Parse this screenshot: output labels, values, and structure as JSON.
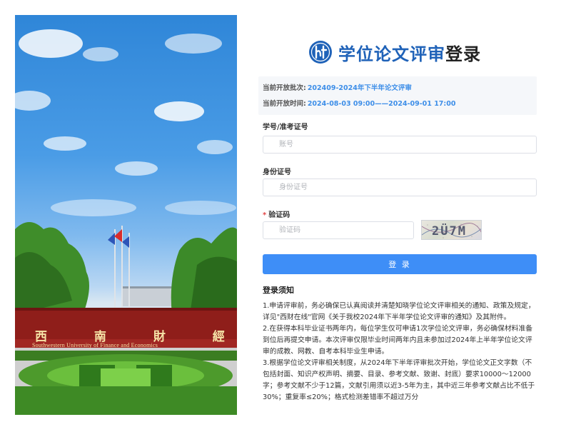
{
  "photo": {
    "school_name_cn": "西 南 財 經 大 學",
    "school_name_en": "Southwestern University of Finance and Economics"
  },
  "header": {
    "logo_icon": "university-emblem-icon",
    "title": "学位论文评审",
    "title_suffix": "登录"
  },
  "batch": {
    "current_batch_label": "当前开放批次:",
    "current_batch_value": "202409-2024年下半年论文评审",
    "current_time_label": "当前开放时间:",
    "current_time_value": "2024-08-03 09:00——2024-09-01 17:00"
  },
  "form": {
    "student_id_label": "学号/准考证号",
    "student_id_placeholder": "账号",
    "id_card_label": "身份证号",
    "id_card_placeholder": "身份证号",
    "captcha_required_mark": "*",
    "captcha_label": "验证码",
    "captcha_placeholder": "验证码",
    "captcha_text": "2Ü7M",
    "login_button": "登 录"
  },
  "notice": {
    "title": "登录须知",
    "items": [
      "1.申请评审前，务必确保已认真阅读并清楚知晓学位论文评审相关的通知、政策及规定，详见\"西财在线\"官网《关于我校2024年下半年学位论文评审的通知》及其附件。",
      "2.在获得本科毕业证书两年内，每位学生仅可申请1次学位论文评审，务必确保材料准备到位后再提交申请。本次评审仅限毕业时间两年内且未参加过2024年上半年学位论文评审的成教、网教、自考本科毕业生申请。",
      "3.根据学位论文评审相关制度，从2024年下半年评审批次开始，学位论文正文字数（不包括封面、知识产权声明、摘要、目录、参考文献、致谢、封底）要求10000～12000字；参考文献不少于12篇，文献引用须以近3-5年为主，其中近三年参考文献占比不低于30%；重复率≤20%；格式检测差错率不超过万分"
    ]
  },
  "colors": {
    "accent": "#3e8ef7",
    "title_blue": "#1f62b8",
    "value_blue": "#3d8ee8",
    "required_red": "#e24545"
  }
}
